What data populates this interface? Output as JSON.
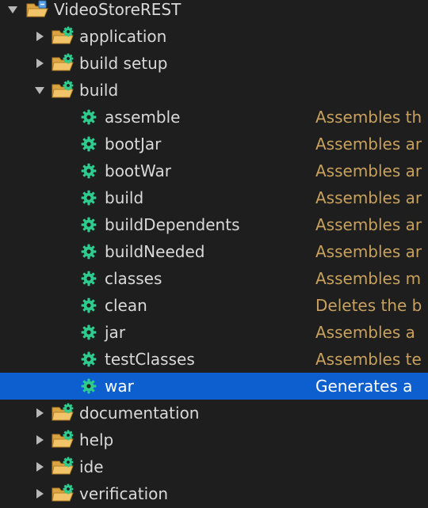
{
  "colors": {
    "background": "#1e1e1e",
    "text": "#d9d9d9",
    "description": "#c8a15f",
    "selection": "#0d5fd0",
    "task_gear": "#2ecc8f",
    "folder": "#e8b04b"
  },
  "tree": {
    "root": {
      "label": "VideoStoreREST",
      "expanded": true,
      "icon": "project-folder-icon"
    },
    "groups": [
      {
        "key": "application",
        "label": "application",
        "expanded": false
      },
      {
        "key": "build-setup",
        "label": "build setup",
        "expanded": false
      },
      {
        "key": "build",
        "label": "build",
        "expanded": true
      },
      {
        "key": "documentation",
        "label": "documentation",
        "expanded": false
      },
      {
        "key": "help",
        "label": "help",
        "expanded": false
      },
      {
        "key": "ide",
        "label": "ide",
        "expanded": false
      },
      {
        "key": "verification",
        "label": "verification",
        "expanded": false
      }
    ],
    "build_tasks": [
      {
        "label": "assemble",
        "description": "Assembles th",
        "selected": false
      },
      {
        "label": "bootJar",
        "description": "Assembles ar",
        "selected": false
      },
      {
        "label": "bootWar",
        "description": "Assembles ar",
        "selected": false
      },
      {
        "label": "build",
        "description": "Assembles ar",
        "selected": false
      },
      {
        "label": "buildDependents",
        "description": "Assembles ar",
        "selected": false
      },
      {
        "label": "buildNeeded",
        "description": "Assembles ar",
        "selected": false
      },
      {
        "label": "classes",
        "description": "Assembles m",
        "selected": false
      },
      {
        "label": "clean",
        "description": "Deletes the b",
        "selected": false
      },
      {
        "label": "jar",
        "description": "Assembles a",
        "selected": false
      },
      {
        "label": "testClasses",
        "description": "Assembles te",
        "selected": false
      },
      {
        "label": "war",
        "description": "Generates a",
        "selected": true
      }
    ]
  }
}
